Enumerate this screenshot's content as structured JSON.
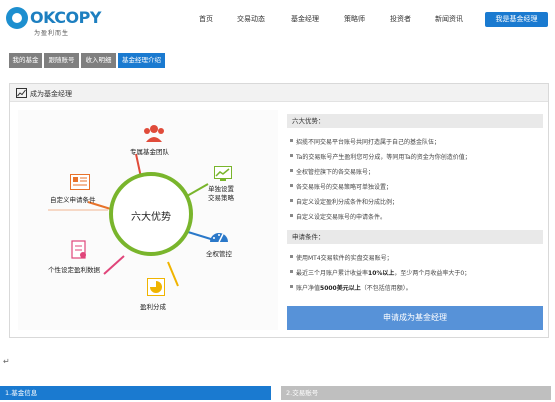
{
  "brand": {
    "name": "OKCOPY",
    "slogan": "为盈利而生"
  },
  "nav": {
    "items": [
      "首页",
      "交易动态",
      "基金经理",
      "策略师",
      "投资者",
      "新闻资讯"
    ],
    "cta": "我是基金经理"
  },
  "tabs": [
    "我的基金",
    "跟随账号",
    "收入明细",
    "基金经理介绍"
  ],
  "card": {
    "title": "成为基金经理"
  },
  "advantages": {
    "center": "六大优势",
    "features": [
      {
        "label": "专属基金团队",
        "icon": "team-icon",
        "color": "#e04b3a"
      },
      {
        "label": "单独设置\n交易策略",
        "icon": "strategy-icon",
        "color": "#79b52c"
      },
      {
        "label": "全权管控",
        "icon": "gauge-icon",
        "color": "#2a78c9"
      },
      {
        "label": "盈利分成",
        "icon": "profit-share-icon",
        "color": "#f0b400"
      },
      {
        "label": "个性设定盈利数据",
        "icon": "data-icon",
        "color": "#e0457a"
      },
      {
        "label": "自定义申请条件",
        "icon": "form-icon",
        "color": "#e8722a"
      }
    ]
  },
  "six_adv": {
    "title": "六大优势：",
    "items": [
      "招揽不同交易平台账号共同打造属于自己的基金队伍；",
      "Ta的交易账号产生盈利您可分成，等同用Ta的资金为你创造价值；",
      "全权管控旗下的各交易账号；",
      "各交易账号的交易策略可单独设置；",
      "自定义设定盈利分成条件和分成比例；",
      "自定义设定交易账号的申请条件。"
    ]
  },
  "conditions": {
    "title": "申请条件：",
    "c1": "使用MT4交易软件的实盘交易账号；",
    "c2_a": "最近三个月账户累计收益率",
    "c2_b": "10%以上",
    "c2_c": "，至少两个月收益率大于0；",
    "c3_a": "账户净值",
    "c3_b": "5000美元以上",
    "c3_c": "（不包括信用额）。"
  },
  "apply_button": "申请成为基金经理",
  "steps": [
    "1.基金信息",
    "2.交易账号"
  ],
  "colors": {
    "primary": "#1a7ad0",
    "ring": "#79b52c",
    "apply": "#5792d8"
  }
}
